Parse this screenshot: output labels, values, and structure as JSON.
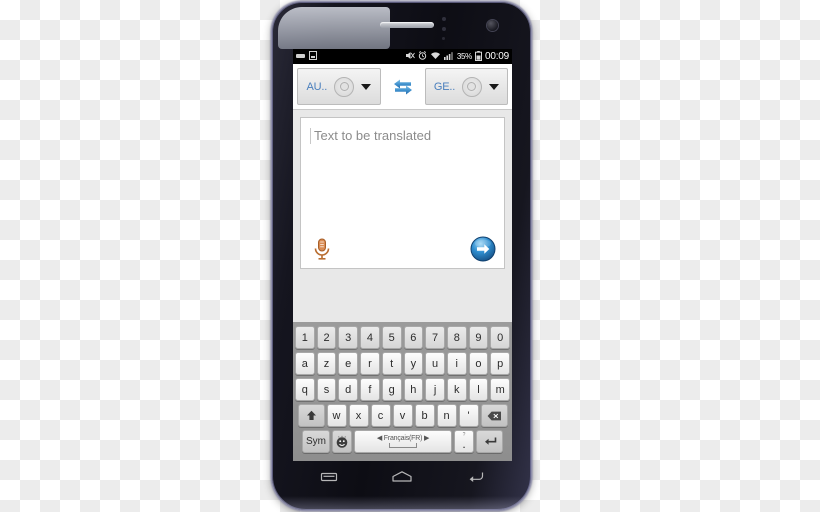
{
  "device": {
    "type": "android-smartphone",
    "icons": {
      "earpiece": "earpiece-speaker",
      "front_camera": "front-camera-icon",
      "proximity_sensor": "proximity-sensor-icon"
    }
  },
  "status_bar": {
    "left_icons": [
      "usb-debug-icon",
      "sd-card-icon"
    ],
    "right_icons": [
      "mute-icon",
      "alarm-icon",
      "wifi-icon",
      "signal-icon"
    ],
    "battery_percent": "35%",
    "battery_icon": "battery-icon",
    "clock": "00:09"
  },
  "language_bar": {
    "source": {
      "label": "AU..",
      "speaker_icon": "speaker-icon",
      "dropdown_icon": "chevron-down-icon"
    },
    "swap_icon": "swap-languages-icon",
    "target": {
      "label": "GE..",
      "speaker_icon": "speaker-icon",
      "dropdown_icon": "chevron-down-icon"
    },
    "accent_color": "#4a7fbd"
  },
  "translate_card": {
    "source_placeholder": "Text to be translated",
    "source_value": "",
    "mic_icon": "microphone-icon",
    "mic_color": "#c8723a",
    "translate_icon": "arrow-right-circle-icon",
    "translate_color": "#1f77c4"
  },
  "keyboard": {
    "layout_name": "Français(FR)",
    "rows": {
      "numbers": [
        "1",
        "2",
        "3",
        "4",
        "5",
        "6",
        "7",
        "8",
        "9",
        "0"
      ],
      "row1": [
        "a",
        "z",
        "e",
        "r",
        "t",
        "y",
        "u",
        "i",
        "o",
        "p"
      ],
      "row2": [
        "q",
        "s",
        "d",
        "f",
        "g",
        "h",
        "j",
        "k",
        "l",
        "m"
      ],
      "row3": [
        "w",
        "x",
        "c",
        "v",
        "b",
        "n",
        "'"
      ]
    },
    "shift_icon": "shift-up-icon",
    "backspace_icon": "backspace-icon",
    "sym_label": "Sym",
    "emoji_icon": "emoji-icon",
    "space_left_arrow": "◀",
    "space_right_arrow": "▶",
    "period_key": ".",
    "period_key_alt": "?",
    "enter_icon": "enter-icon"
  },
  "nav_bar": {
    "recents_icon": "recents-icon",
    "home_icon": "home-icon",
    "back_icon": "back-icon"
  }
}
